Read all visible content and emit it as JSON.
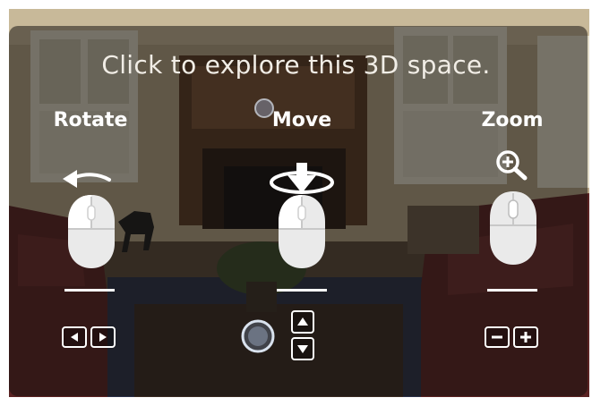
{
  "overlay": {
    "headline": "Click to explore this 3D space."
  },
  "controls": [
    {
      "id": "rotate",
      "label": "Rotate",
      "gesture_icon": "arrow-left-icon",
      "keys": [
        "arrow-left-key",
        "arrow-right-key"
      ]
    },
    {
      "id": "move",
      "label": "Move",
      "gesture_icon": "arrow-down-ring-icon",
      "keys": [
        "arrow-up-key",
        "arrow-down-key"
      ]
    },
    {
      "id": "zoom",
      "label": "Zoom",
      "gesture_icon": "magnifier-plus-icon",
      "keys": [
        "minus-key",
        "plus-key"
      ]
    }
  ],
  "colors": {
    "overlay": "#12100e",
    "text": "#ffffff",
    "mouse_body": "#e9e9e9",
    "key_border": "#ffffff"
  }
}
